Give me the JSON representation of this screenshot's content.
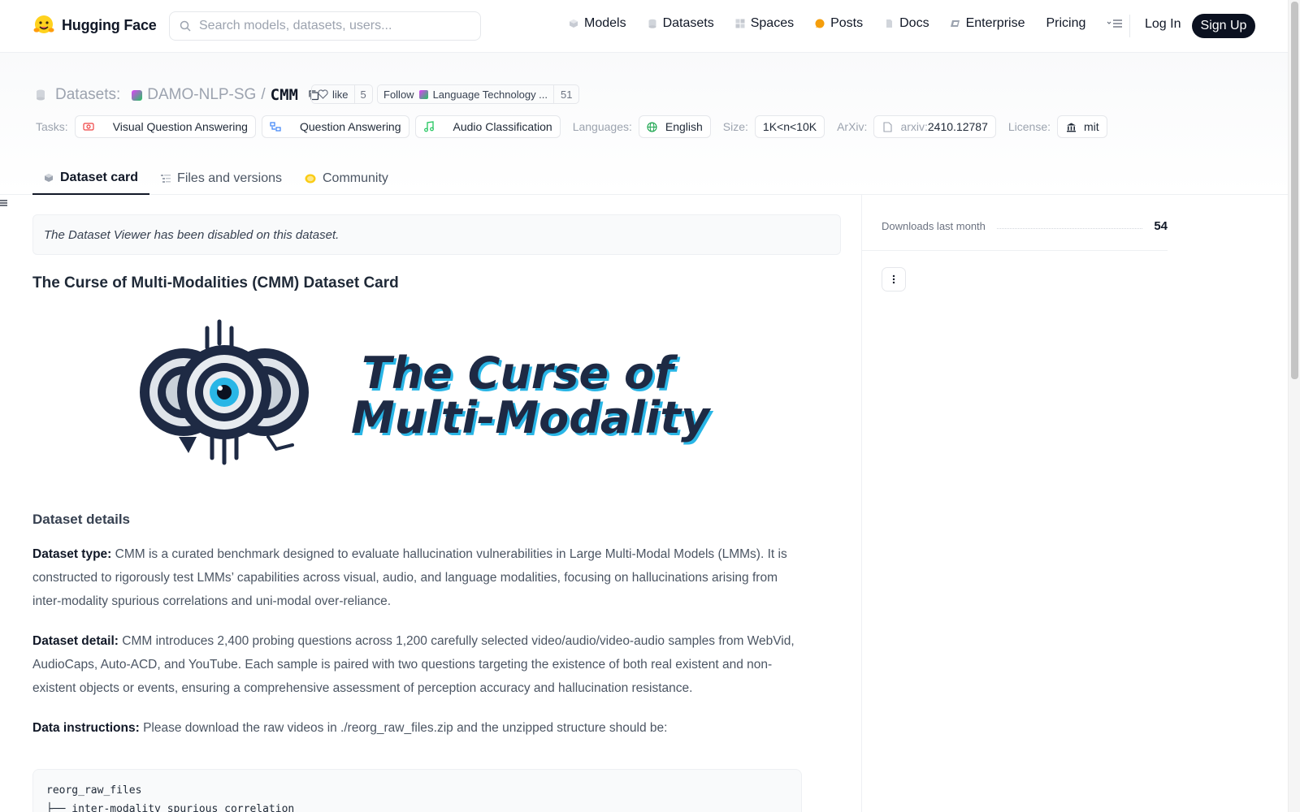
{
  "nav": {
    "brand": "Hugging Face",
    "search_placeholder": "Search models, datasets, users...",
    "items": [
      {
        "label": "Models",
        "icon": "models-icon"
      },
      {
        "label": "Datasets",
        "icon": "datasets-icon"
      },
      {
        "label": "Spaces",
        "icon": "spaces-icon"
      },
      {
        "label": "Posts",
        "icon": "posts-icon"
      },
      {
        "label": "Docs",
        "icon": "docs-icon"
      },
      {
        "label": "Enterprise",
        "icon": "enterprise-icon"
      },
      {
        "label": "Pricing"
      }
    ],
    "login": "Log In",
    "signup": "Sign Up"
  },
  "repo": {
    "type_label": "Datasets:",
    "org": "DAMO-NLP-SG",
    "separator": "/",
    "name": "CMM",
    "like_label": "like",
    "like_count": "5",
    "follow_label": "Follow",
    "follow_org": "Language Technology ...",
    "follow_count": "51"
  },
  "tags": {
    "tasks_label": "Tasks:",
    "tasks": [
      "Visual Question Answering",
      "Question Answering",
      "Audio Classification"
    ],
    "languages_label": "Languages:",
    "language": "English",
    "size_label": "Size:",
    "size": "1K<n<10K",
    "arxiv_label": "ArXiv:",
    "arxiv_prefix": "arxiv:",
    "arxiv_id": "2410.12787",
    "license_label": "License:",
    "license": "mit"
  },
  "tabs": [
    {
      "label": "Dataset card",
      "active": true
    },
    {
      "label": "Files and versions",
      "active": false
    },
    {
      "label": "Community",
      "active": false
    }
  ],
  "card": {
    "viewer_note": "The Dataset Viewer has been disabled on this dataset.",
    "title": "The Curse of Multi-Modalities (CMM) Dataset Card",
    "banner_line1": "The Curse of",
    "banner_line2": "Multi-Modality",
    "section_details": "Dataset details",
    "type_label": "Dataset type:",
    "type_text": "CMM is a curated benchmark designed to evaluate hallucination vulnerabilities in Large Multi-Modal Models (LMMs). It is constructed to rigorously test LMMs’ capabilities across visual, audio, and language modalities, focusing on hallucinations arising from inter-modality spurious correlations and uni-modal over-reliance.",
    "detail_label": "Dataset detail:",
    "detail_text": "CMM introduces 2,400 probing questions across 1,200 carefully selected video/audio/video-audio samples from WebVid, AudioCaps, Auto-ACD, and YouTube. Each sample is paired with two questions targeting the existence of both real existent and non-existent objects or events, ensuring a comprehensive assessment of perception accuracy and hallucination resistance.",
    "instructions_label": "Data instructions:",
    "instructions_text": "Please download the raw videos in ./reorg_raw_files.zip and the unzipped structure should be:",
    "code_line1": "reorg_raw_files",
    "code_line2": "├── inter-modality_spurious_correlation"
  },
  "sidebar": {
    "downloads_label": "Downloads last month",
    "downloads_value": "54"
  },
  "colors": {
    "accent_dark": "#0b1120",
    "banner_blue": "#29b6e6",
    "banner_navy": "#1e2a44"
  }
}
